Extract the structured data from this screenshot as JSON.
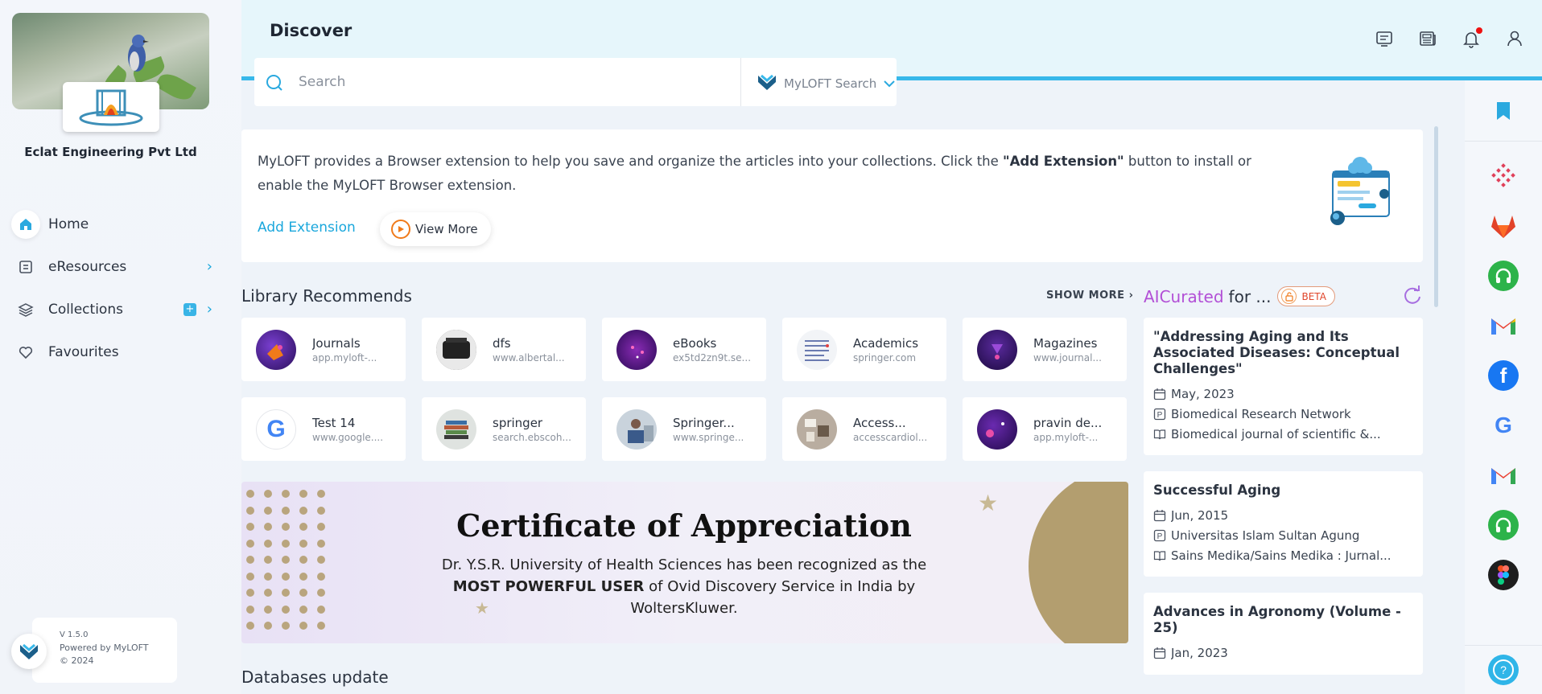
{
  "org": {
    "name": "Eclat Engineering Pvt Ltd"
  },
  "nav": [
    {
      "label": "Home",
      "icon": "home-icon"
    },
    {
      "label": "eResources",
      "icon": "eresources-icon"
    },
    {
      "label": "Collections",
      "icon": "layers-icon"
    },
    {
      "label": "Favourites",
      "icon": "heart-icon"
    }
  ],
  "footer": {
    "version": "V 1.5.0",
    "powered": "Powered by MyLOFT",
    "copyright": "© 2024"
  },
  "header": {
    "title": "Discover"
  },
  "search": {
    "placeholder": "Search",
    "source": "MyLOFT Search"
  },
  "extension": {
    "text_1": "MyLOFT provides a Browser extension to help you save and organize the articles into your collections. Click the ",
    "text_bold": "\"Add Extension\"",
    "text_2": " button to install or enable the MyLOFT Browser extension.",
    "add_label": "Add Extension",
    "view_more_label": "View More"
  },
  "library": {
    "title": "Library Recommends",
    "show_more": "SHOW MORE",
    "items": [
      {
        "name": "Journals",
        "url": "app.myloft-..."
      },
      {
        "name": "dfs",
        "url": "www.albertal..."
      },
      {
        "name": "eBooks",
        "url": "ex5td2zn9t.se..."
      },
      {
        "name": "Academics",
        "url": "springer.com"
      },
      {
        "name": "Magazines",
        "url": "www.journal..."
      },
      {
        "name": "Test 14",
        "url": "www.google...."
      },
      {
        "name": "springer",
        "url": "search.ebscoh..."
      },
      {
        "name": "Springer...",
        "url": "www.springe..."
      },
      {
        "name": "Access...",
        "url": "accesscardiol..."
      },
      {
        "name": "pravin de...",
        "url": "app.myloft-..."
      }
    ]
  },
  "certificate": {
    "heading": "Certificate of Appreciation",
    "line1": "Dr. Y.S.R. University of Health Sciences has been recognized as the",
    "line2_bold": "MOST POWERFUL USER",
    "line2_rest": " of Ovid Discovery Service in India by",
    "line3": "WoltersKluwer."
  },
  "databases": {
    "title": "Databases update"
  },
  "ai": {
    "title_ai": "AICurated",
    "title_rest": "for ...",
    "badge": "BETA",
    "cards": [
      {
        "title": "\"Addressing Aging and Its Associated Diseases: Conceptual Challenges\"",
        "date": "May, 2023",
        "publisher": "Biomedical Research Network",
        "journal": "Biomedical journal of scientific &..."
      },
      {
        "title": "Successful Aging",
        "date": "Jun, 2015",
        "publisher": "Universitas Islam Sultan Agung",
        "journal": "Sains Medika/Sains Medika : Jurnal..."
      },
      {
        "title": "Advances in Agronomy (Volume - 25)",
        "date": "Jan, 2023"
      }
    ]
  },
  "colors": {
    "accent": "#1aa7dc",
    "header_bg": "#e6f6fb",
    "ai_purple": "#b24fd6"
  }
}
